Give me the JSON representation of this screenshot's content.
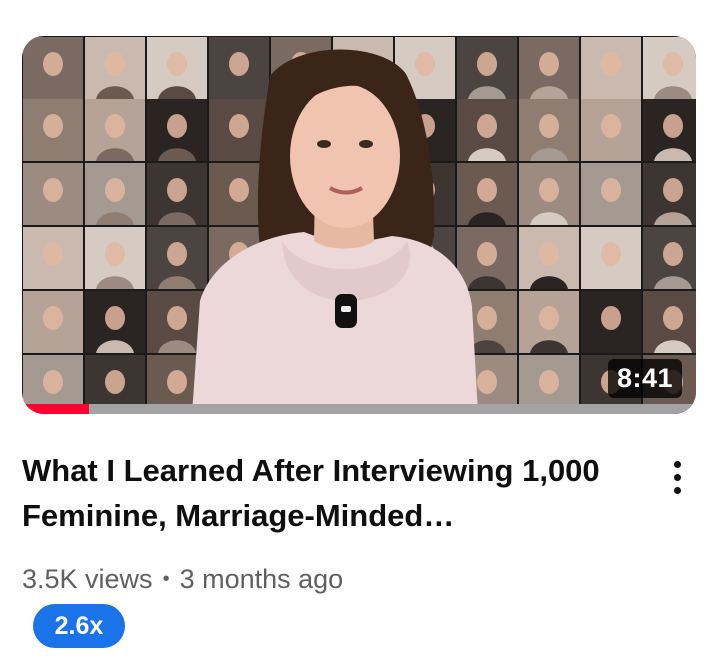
{
  "video": {
    "duration": "8:41",
    "watch_progress": 0.1,
    "title": "What I Learned After Interviewing 1,000 Feminine, Marriage-Minded…",
    "views": "3.5K views",
    "separator": "•",
    "age": "3 months ago",
    "badge": "2.6x"
  },
  "icons": {
    "menu": "more-vert-icon"
  },
  "colors": {
    "progress": "#ff0033",
    "badge": "#1a73e8",
    "title": "#0f0f0f",
    "meta": "#606060"
  }
}
